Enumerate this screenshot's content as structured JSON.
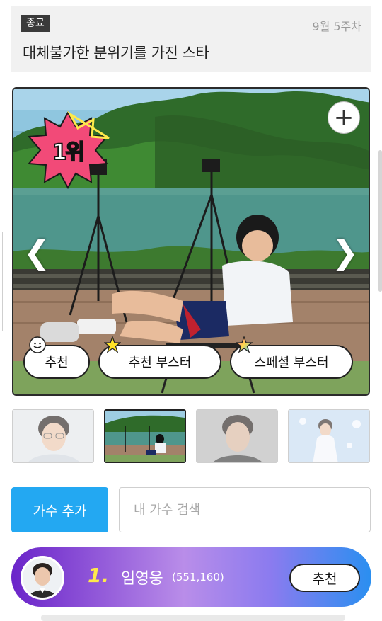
{
  "header": {
    "status_badge": "종료",
    "week": "9월 5주차",
    "title": "대체불가한 분위기를 가진 스타"
  },
  "main_photo": {
    "rank_label": "1위",
    "plus": "+",
    "prev_arrow": "❮",
    "next_arrow": "❯"
  },
  "vote_buttons": {
    "recommend": "추천",
    "booster": "추천 부스터",
    "special_booster": "스페셜 부스터"
  },
  "thumbnails": [
    {
      "selected": false
    },
    {
      "selected": true
    },
    {
      "selected": false
    },
    {
      "selected": false
    }
  ],
  "search": {
    "add_button": "가수 추가",
    "placeholder": "내 가수 검색"
  },
  "ranking": [
    {
      "rank": "1.",
      "name": "임영웅",
      "votes": "(551,160)",
      "button": "추천"
    }
  ],
  "colors": {
    "accent_blue": "#23a8f2",
    "rank_burst": "#f24a78",
    "rank_number": "#ffe94a"
  },
  "icons": [
    "plus-icon",
    "chevron-left-icon",
    "chevron-right-icon",
    "smile-icon",
    "star-icon",
    "rainbow-star-icon"
  ]
}
